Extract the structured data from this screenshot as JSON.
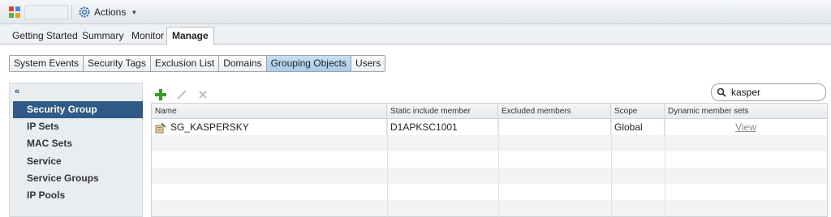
{
  "toolbar": {
    "actions_label": "Actions",
    "title": ""
  },
  "main_tabs": [
    "Getting Started",
    "Summary",
    "Monitor",
    "Manage"
  ],
  "sub_tabs": [
    "System Events",
    "Security Tags",
    "Exclusion List",
    "Domains",
    "Grouping Objects",
    "Users"
  ],
  "sidebar": {
    "collapse_glyph": "«",
    "items": [
      "Security Group",
      "IP Sets",
      "MAC Sets",
      "Service",
      "Service Groups",
      "IP Pools"
    ],
    "selected": "Security Group"
  },
  "search": {
    "value": "kasper"
  },
  "grid": {
    "columns": [
      "Name",
      "Static include member",
      "Excluded members",
      "Scope",
      "Dynamic member sets"
    ],
    "rows": [
      {
        "name": "SG_KASPERSKY",
        "static": "D1APKSC1001",
        "excluded": "",
        "scope": "Global",
        "dynamic": "View"
      }
    ]
  },
  "colors": {
    "selected_nav": "#2f5a86",
    "active_subtab": "#a9cbeb",
    "add_icon": "#3a9a2a"
  }
}
